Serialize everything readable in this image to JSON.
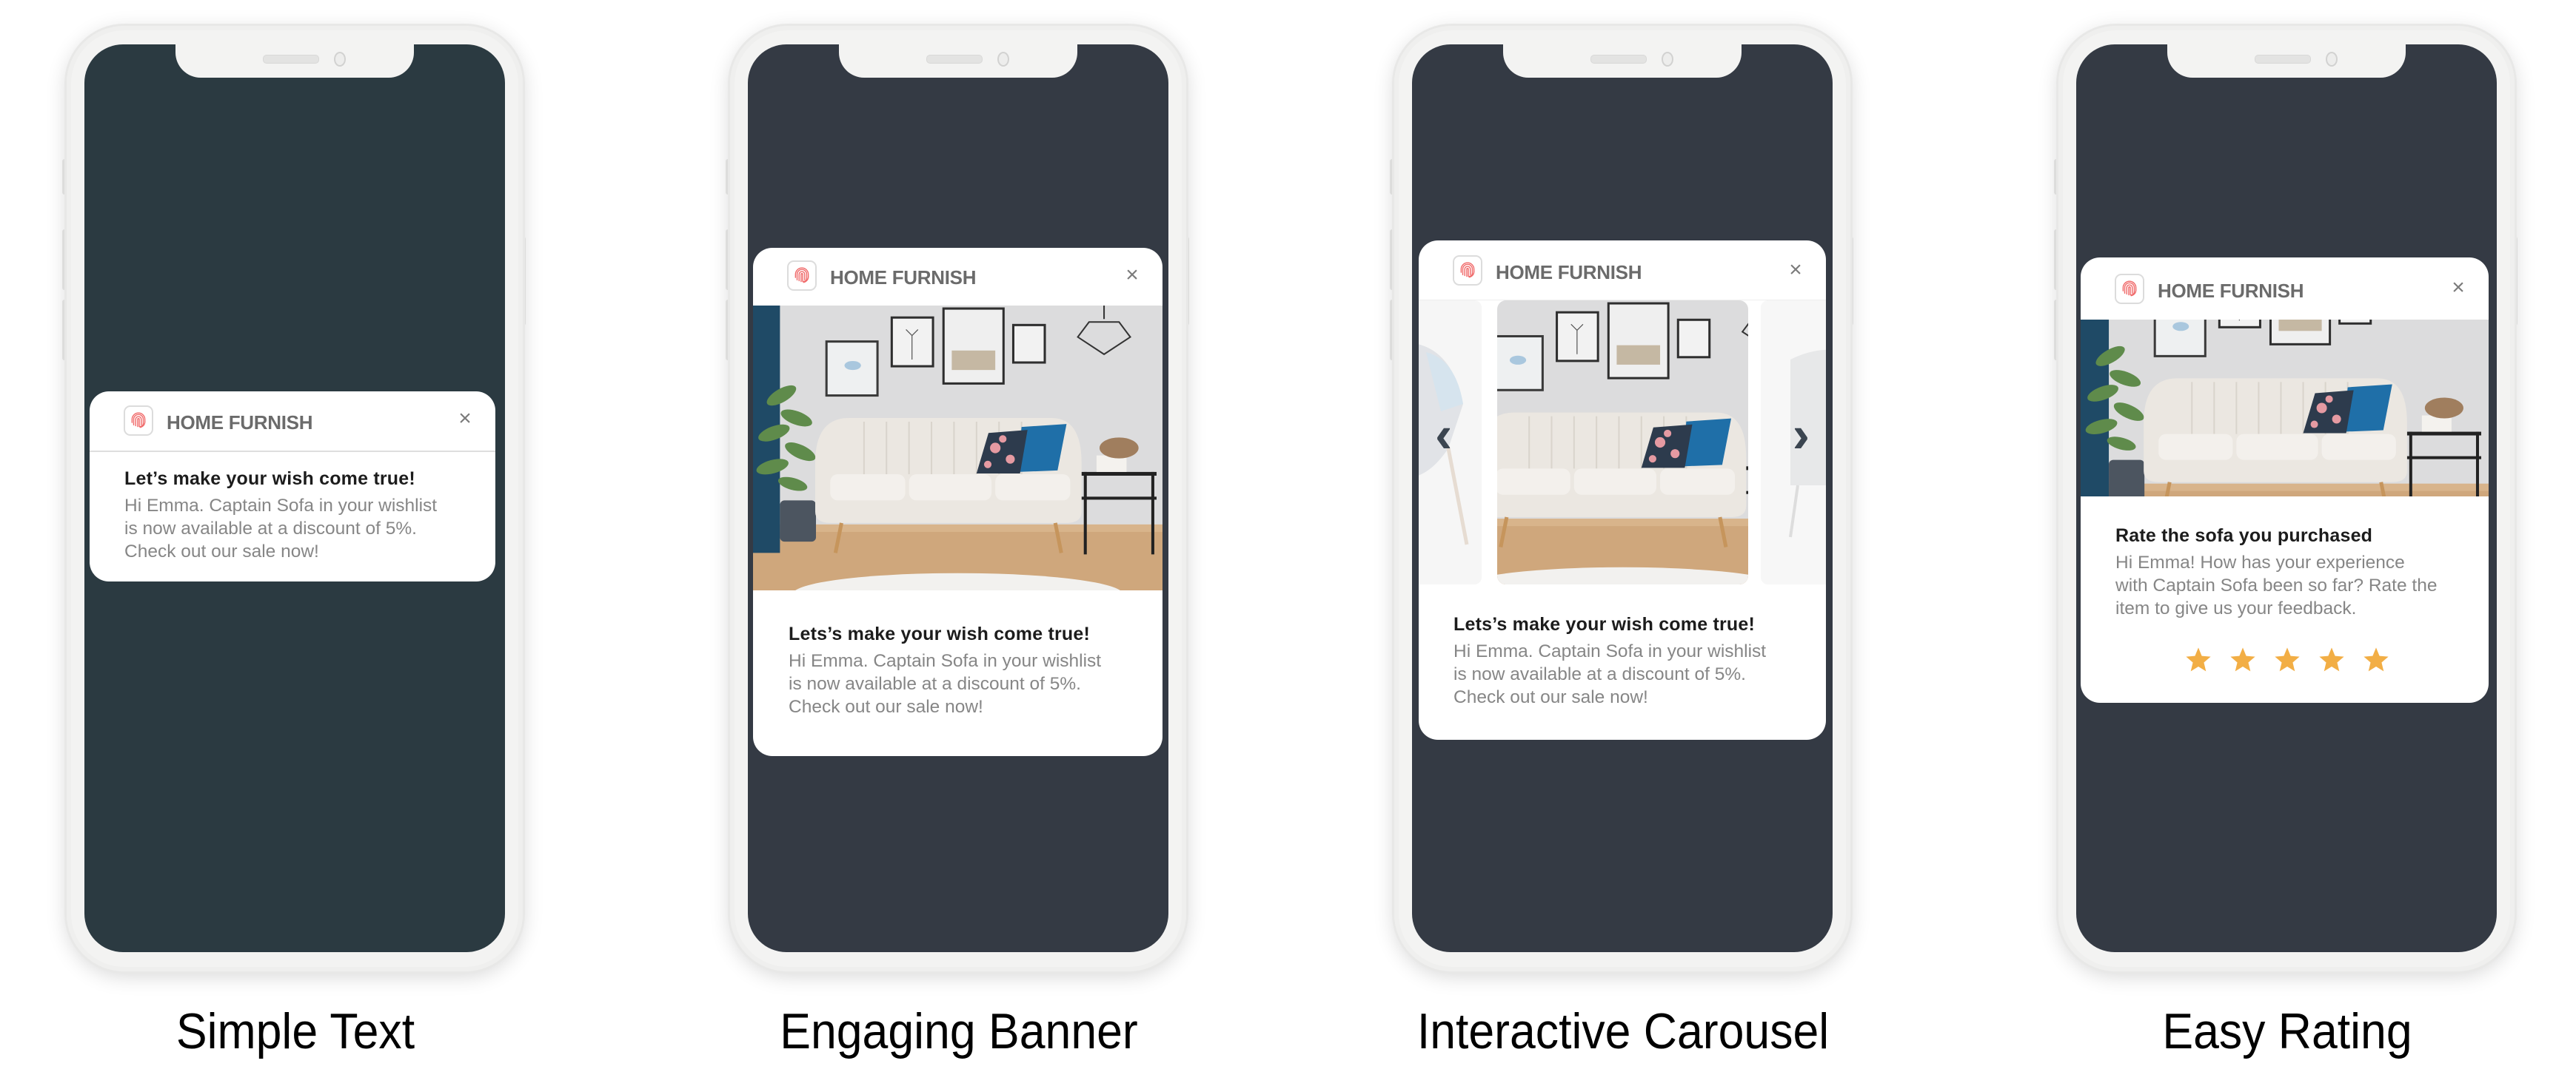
{
  "brand": {
    "name": "HOME FURNISH",
    "icon": "fingerprint-icon",
    "accent_color": "#f06a6a",
    "close_icon": "close-icon",
    "close_glyph": "×"
  },
  "phones": [
    {
      "caption": "Simple Text",
      "screen_color": "#2b3a41",
      "card": {
        "title": "Let’s make your wish come true!",
        "body": "Hi Emma. Captain Sofa in your wishlist\nis now available at a discount of 5%.\nCheck out our sale now!"
      }
    },
    {
      "caption": "Engaging Banner",
      "screen_color": "#343a44",
      "card": {
        "image": "living-room-sofa-photo",
        "title": "Lets’s make your wish come true!",
        "body": "Hi Emma. Captain Sofa in your wishlist\nis now available at a discount of 5%.\nCheck out our sale now!"
      }
    },
    {
      "caption": "Interactive Carousel",
      "screen_color": "#343a44",
      "card": {
        "carousel": {
          "prev_icon": "chevron-left-icon",
          "next_icon": "chevron-right-icon",
          "prev_glyph": "‹",
          "next_glyph": "›",
          "slides": [
            "patterned-chair-photo",
            "living-room-sofa-photo",
            "grey-armchair-photo"
          ],
          "active_index": 1
        },
        "title": "Lets’s make your wish come true!",
        "body": "Hi Emma. Captain Sofa in your wishlist\nis now available at a discount of 5%.\nCheck out our sale now!"
      }
    },
    {
      "caption": "Easy Rating",
      "screen_color": "#343a44",
      "card": {
        "image": "living-room-sofa-photo",
        "title": "Rate the sofa you purchased",
        "body": "Hi Emma! How has your experience\nwith Captain Sofa been so far? Rate the\nitem to give us your feedback.",
        "rating": {
          "stars_total": 5,
          "stars_shown": 5,
          "star_color": "#f2ae45"
        }
      }
    }
  ]
}
